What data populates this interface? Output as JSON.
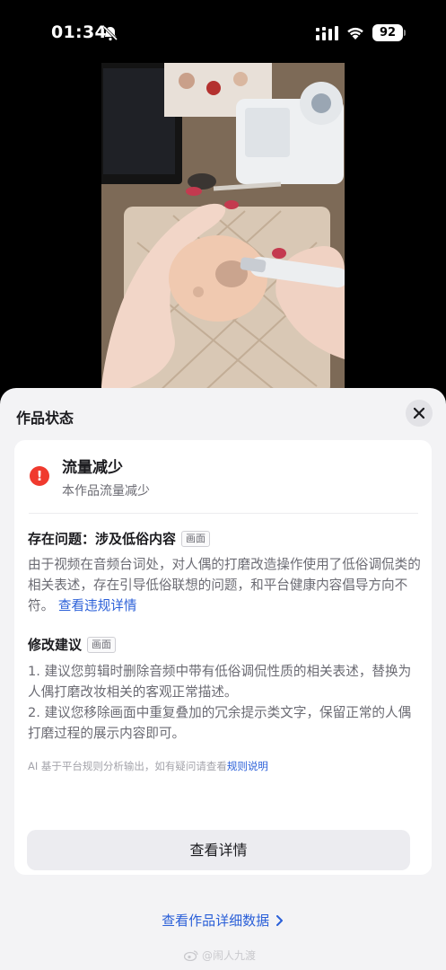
{
  "status_bar": {
    "time": "01:34",
    "battery": "92",
    "icons": [
      "bell-off-icon",
      "cellular-signal-icon",
      "wifi-icon",
      "battery-icon"
    ]
  },
  "video": {
    "description_icon": "video-thumbnail"
  },
  "sheet": {
    "title": "作品状态",
    "close_icon": "close-icon",
    "status": {
      "icon": "alert-icon",
      "icon_glyph": "!",
      "title": "流量减少",
      "subtitle": "本作品流量减少",
      "color": "#f03a2e"
    },
    "issue": {
      "label": "存在问题：涉及低俗内容",
      "tag": "画面",
      "body": "由于视频在音频台词处，对人偶的打磨改造操作使用了低俗调侃类的相关表述，存在引导低俗联想的问题，和平台健康内容倡导方向不符。",
      "link": "查看违规详情"
    },
    "advice": {
      "label": "修改建议",
      "tag": "画面",
      "item1": "1. 建议您剪辑时删除音频中带有低俗调侃性质的相关表述，替换为人偶打磨改妆相关的客观正常描述。",
      "item2": "2. 建议您移除画面中重复叠加的冗余提示类文字，保留正常的人偶打磨过程的展示内容即可。"
    },
    "footnote": {
      "text": "AI 基于平台规则分析输出，如有疑问请查看",
      "link": "规则说明"
    },
    "primary_button": "查看详情",
    "more_data": "查看作品详细数据",
    "more_data_icon": "chevron-right-icon",
    "link_color": "#2a5fd8"
  },
  "watermark": "@闹人九渡"
}
